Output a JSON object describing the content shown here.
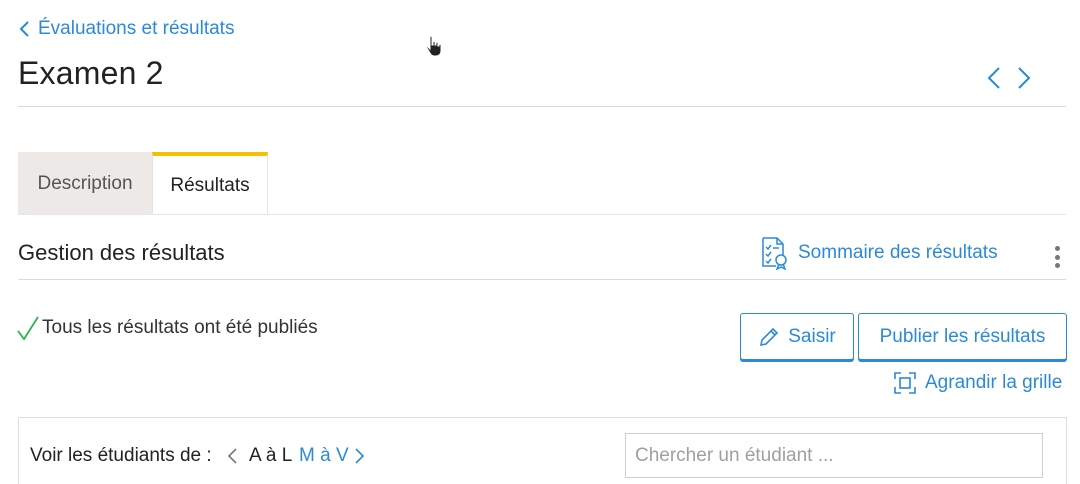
{
  "breadcrumb": {
    "back_label": "Évaluations et résultats"
  },
  "page": {
    "title": "Examen 2"
  },
  "tabs": [
    {
      "label": "Description",
      "active": false
    },
    {
      "label": "Résultats",
      "active": true
    }
  ],
  "section": {
    "title": "Gestion des résultats",
    "summary_link": "Sommaire des résultats"
  },
  "status": {
    "message": "Tous les résultats ont été publiés"
  },
  "actions": {
    "edit_label": "Saisir",
    "publish_label": "Publier les résultats",
    "expand_label": "Agrandir la grille"
  },
  "filter": {
    "label": "Voir les étudiants de :",
    "ranges": [
      "A à L",
      "M à V"
    ],
    "active_range": "A à L",
    "search_placeholder": "Chercher un étudiant ..."
  },
  "colors": {
    "accent": "#2b8ad8",
    "active_tab_indicator": "#f2c200",
    "success": "#2bb24c",
    "inactive_tab_bg": "#ece9e6"
  },
  "icons": [
    "chevron-left-icon",
    "chevron-right-icon",
    "pointer-cursor-icon",
    "checklist-icon",
    "more-vertical-icon",
    "checkmark-icon",
    "pencil-icon",
    "expand-icon"
  ]
}
